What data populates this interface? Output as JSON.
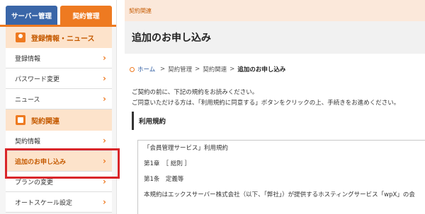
{
  "sidebar": {
    "tabs": [
      {
        "label": "サーバー管理"
      },
      {
        "label": "契約管理"
      }
    ],
    "sections": [
      {
        "title": "登録情報・ニュース",
        "items": [
          "登録情報",
          "パスワード変更",
          "ニュース"
        ]
      },
      {
        "title": "契約関連",
        "items": [
          "契約情報",
          "追加のお申し込み",
          "プランの変更",
          "オートスケール設定"
        ]
      }
    ],
    "active_item": "追加のお申し込み"
  },
  "main": {
    "top_label": "契約関連",
    "title": "追加のお申し込み",
    "breadcrumb": [
      "ホーム",
      "契約管理",
      "契約関連",
      "追加のお申し込み"
    ],
    "intro_lines": [
      "ご契約の前に、下記の規約をお読みください。",
      "ご同意いただける方は、「利用規約に同意する」ボタンをクリックの上、手続きをお進めください。"
    ],
    "terms_heading": "利用規約",
    "terms_lines": [
      "「会員管理サービス」利用規約",
      "第1章　［ 総則 ］",
      "第1条　定義等",
      "本規約はエックスサーバー株式会社（以下、「弊社」）が提供するホスティングサービス「wpX」の会"
    ]
  },
  "colors": {
    "accent": "#ee7a21",
    "server_tab": "#3a66a8",
    "highlight": "#d9262a"
  }
}
